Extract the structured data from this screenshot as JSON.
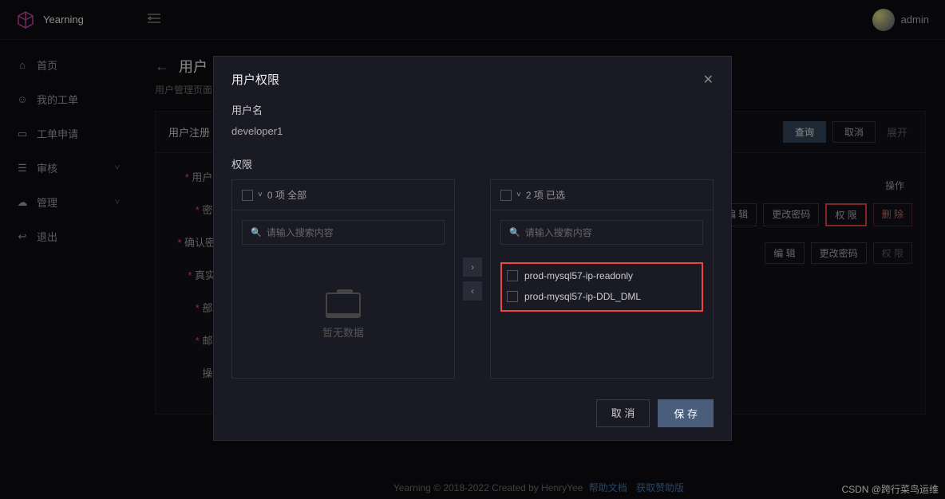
{
  "app": {
    "name": "Yearning",
    "user": "admin"
  },
  "sidebar": {
    "items": [
      {
        "label": "首页",
        "icon": "home",
        "chev": false
      },
      {
        "label": "我的工单",
        "icon": "user",
        "chev": false
      },
      {
        "label": "工单申请",
        "icon": "monitor",
        "chev": false
      },
      {
        "label": "审核",
        "icon": "clipboard",
        "chev": true
      },
      {
        "label": "管理",
        "icon": "cloud",
        "chev": true
      },
      {
        "label": "退出",
        "icon": "exit",
        "chev": false
      }
    ]
  },
  "page": {
    "title": "用户",
    "subtitle": "用户管理页面",
    "panel_title": "用户注册",
    "form": {
      "username": "用户名:",
      "password": "密码:",
      "confirm": "确认密码",
      "realname": "真实姓",
      "dept": "部门:",
      "email": "邮箱:",
      "action": "操作:"
    },
    "query": {
      "q": "查询",
      "cancel": "取消",
      "expand": "展开"
    },
    "table": {
      "op_header": "操作",
      "edit": "编 辑",
      "changepw": "更改密码",
      "perm": "权 限",
      "del": "删 除"
    }
  },
  "modal": {
    "title": "用户权限",
    "user_label": "用户名",
    "user_value": "developer1",
    "perm_label": "权限",
    "left": {
      "header": "0 项 全部",
      "search_ph": "请输入搜索内容",
      "empty": "暂无数据"
    },
    "right": {
      "header": "2 项 已选",
      "search_ph": "请输入搜索内容",
      "items": [
        "prod-mysql57-ip-readonly",
        "prod-mysql57-ip-DDL_DML"
      ]
    },
    "cancel": "取 消",
    "save": "保 存"
  },
  "footer": {
    "copyright": "Yearning © 2018-2022 Created by HenryYee",
    "help": "帮助文档",
    "sponsor": "获取赞助版"
  },
  "watermark": "CSDN @跨行菜鸟运维"
}
